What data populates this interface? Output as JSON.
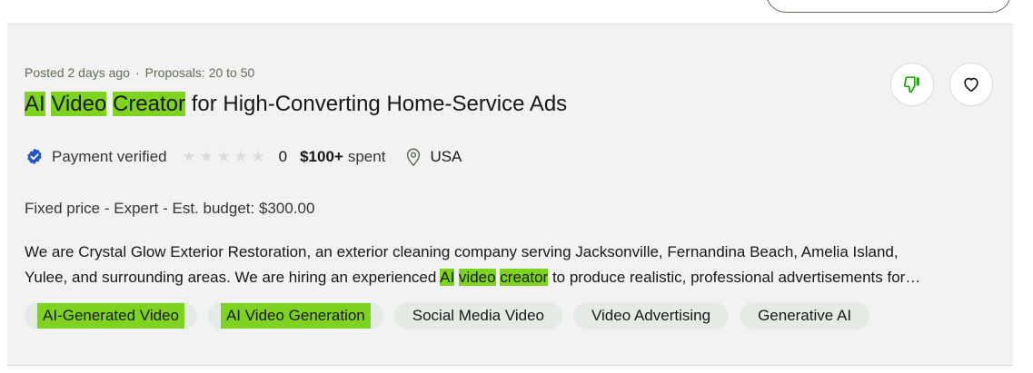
{
  "job": {
    "posted": "Posted 2 days ago",
    "separator": "·",
    "proposals": "Proposals: 20 to 50",
    "title_parts": [
      "AI",
      "Video",
      "Creator",
      "for High-Converting Home-Service Ads"
    ],
    "client": {
      "payment_verified": "Payment verified",
      "rating_count": "0",
      "spent_amount": "$100+",
      "spent_label": "spent",
      "location": "USA",
      "stars_filled": 0,
      "stars_total": 5
    },
    "budget": {
      "type": "Fixed price",
      "sep1": " - ",
      "level": "Expert",
      "sep2": " - ",
      "label": "Est. budget:",
      "amount": "$300.00"
    },
    "description": {
      "line1": "We are Crystal Glow Exterior Restoration, an exterior cleaning company serving Jacksonville, Fernandina Beach, Amelia Island,",
      "line2_before": "Yulee, and surrounding areas. We are hiring an experienced",
      "hl1": "AI",
      "hl2": "video",
      "hl3": "creator",
      "line2_after": "to produce realistic, professional advertisements for…"
    },
    "tags": [
      "AI-Generated Video",
      "AI Video Generation",
      "Social Media Video",
      "Video Advertising",
      "Generative AI"
    ]
  },
  "colors": {
    "highlight": "#7ed320",
    "card_bg": "#f2f2f2",
    "tag_bg": "#e4ebe4",
    "verified_blue": "#1f57c3",
    "dislike_green": "#14a800"
  },
  "icons": {
    "dislike": "thumbs-down-icon",
    "save": "heart-icon",
    "verified": "verified-badge-icon",
    "location": "location-pin-icon"
  }
}
